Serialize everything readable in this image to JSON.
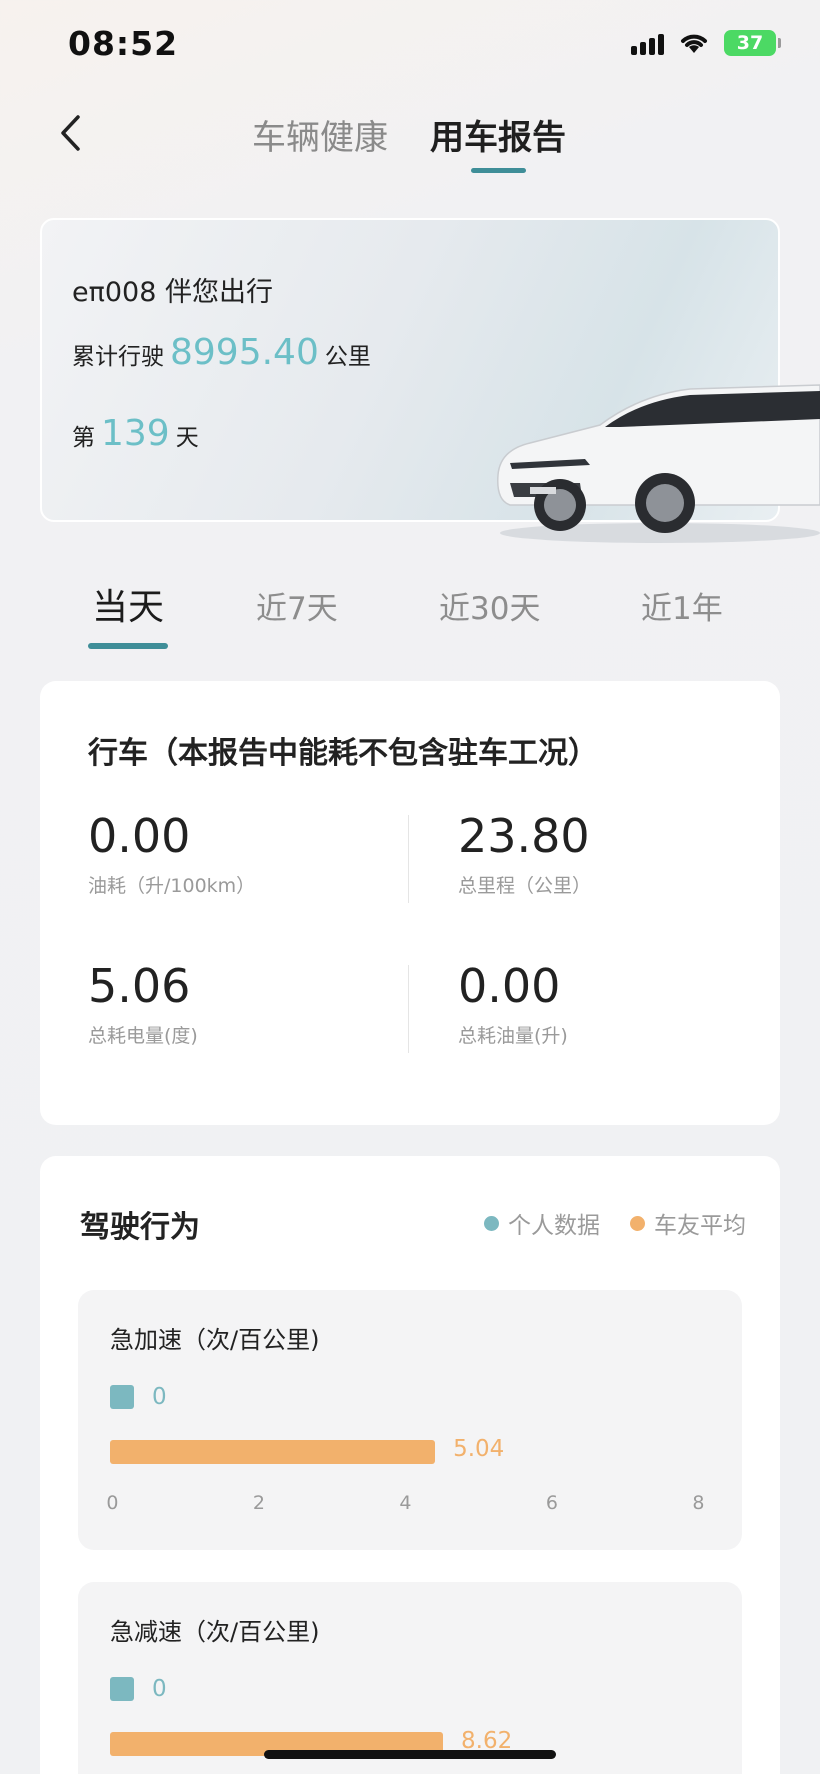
{
  "status_bar": {
    "time": "08:52",
    "battery": "37"
  },
  "header": {
    "tabs": [
      {
        "label": "车辆健康",
        "active": false
      },
      {
        "label": "用车报告",
        "active": true
      }
    ],
    "accent_color": "#3f8e98"
  },
  "hero": {
    "title": "eπ008 伴您出行",
    "mileage_prefix": "累计行驶",
    "mileage_value": "8995.40",
    "mileage_unit": "公里",
    "days_prefix": "第",
    "days_value": "139",
    "days_unit": "天",
    "highlight_color": "#6cbfc7"
  },
  "period_tabs": [
    {
      "label": "当天",
      "active": true
    },
    {
      "label": "近7天",
      "active": false
    },
    {
      "label": "近30天",
      "active": false
    },
    {
      "label": "近1年",
      "active": false
    }
  ],
  "driving": {
    "title": "行车（本报告中能耗不包含驻车工况）",
    "metrics": [
      {
        "value": "0.00",
        "label": "油耗（升/100km）"
      },
      {
        "value": "23.80",
        "label": "总里程（公里）"
      },
      {
        "value": "5.06",
        "label": "总耗电量(度)"
      },
      {
        "value": "0.00",
        "label": "总耗油量(升)"
      }
    ]
  },
  "behavior": {
    "title": "驾驶行为",
    "legend": [
      {
        "label": "个人数据",
        "color": "#7cb8c0"
      },
      {
        "label": "车友平均",
        "color": "#f2b16c"
      }
    ],
    "axis_ticks": [
      "0",
      "2",
      "4",
      "6",
      "8"
    ],
    "axis_max": 8,
    "items": [
      {
        "title": "急加速（次/百公里)",
        "personal": "0",
        "average": "5.04",
        "average_value": 5.04
      },
      {
        "title": "急减速（次/百公里)",
        "personal": "0",
        "average": "8.62",
        "average_value": 8.62
      }
    ]
  }
}
